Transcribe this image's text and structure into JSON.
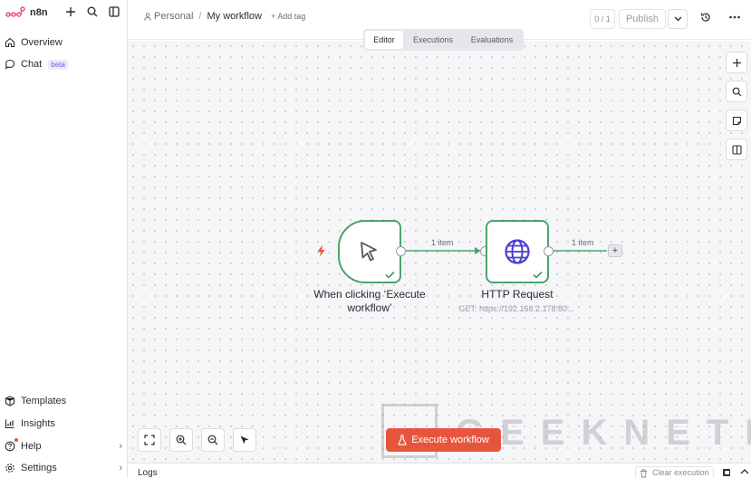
{
  "app": {
    "name": "n8n",
    "brand_color": "#ea4b71"
  },
  "sidebar": {
    "top": [
      {
        "label": "Overview",
        "icon": "home-icon"
      },
      {
        "label": "Chat",
        "icon": "chat-icon",
        "badge": "beta"
      }
    ],
    "bottom": [
      {
        "label": "Templates",
        "icon": "templates-icon"
      },
      {
        "label": "Insights",
        "icon": "chart-icon"
      },
      {
        "label": "Help",
        "icon": "help-icon"
      },
      {
        "label": "Settings",
        "icon": "settings-icon"
      }
    ]
  },
  "header": {
    "breadcrumb_project": "Personal",
    "breadcrumb_sep": "/",
    "workflow_name": "My workflow",
    "add_tag": "+ Add tag",
    "version_count": "0 / 1",
    "publish_label": "Publish"
  },
  "tabs": [
    {
      "label": "Editor",
      "active": true
    },
    {
      "label": "Executions",
      "active": false
    },
    {
      "label": "Evaluations",
      "active": false
    }
  ],
  "workflow": {
    "nodes": [
      {
        "id": "trigger",
        "label": "When clicking ‘Execute workflow’",
        "icon": "cursor-icon",
        "status": "success"
      },
      {
        "id": "http",
        "label": "HTTP Request",
        "subtitle": "GET: https://192.168.2.178:80...",
        "icon": "globe-icon",
        "status": "success"
      }
    ],
    "edges": [
      {
        "label": "1 item"
      },
      {
        "label": "1 item"
      }
    ],
    "success_color": "#4aa56b"
  },
  "execute_button": {
    "label": "Execute workflow",
    "color": "#e8553d"
  },
  "watermark": "GEEKNETIC",
  "logs": {
    "title": "Logs",
    "clear_label": "Clear execution"
  }
}
